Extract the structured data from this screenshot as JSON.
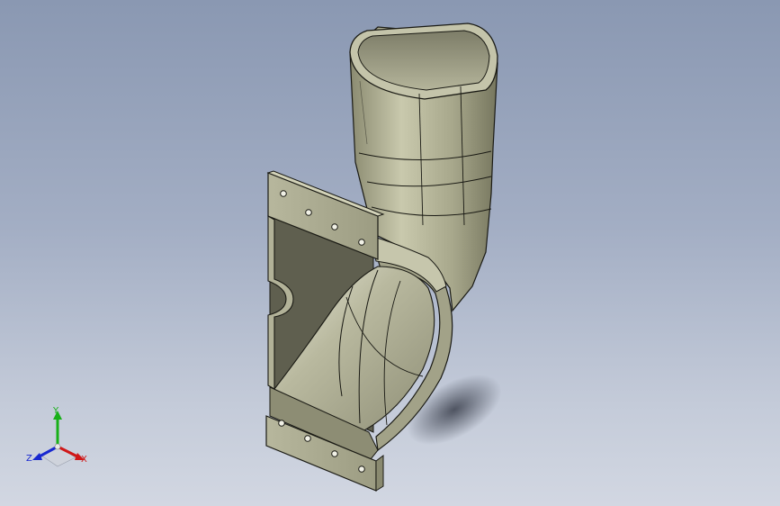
{
  "viewport": {
    "background_top": "#8a98b2",
    "background_bottom": "#d2d7e2"
  },
  "model": {
    "part_color": "#a8a88c",
    "edge_color": "#1a1a14",
    "hole_count_top_flange": 4,
    "hole_count_bottom_flange": 4
  },
  "triad": {
    "x_label": "X",
    "y_label": "Y",
    "z_label": "Z",
    "x_color": "#d01818",
    "y_color": "#18b018",
    "z_color": "#1828d0"
  }
}
